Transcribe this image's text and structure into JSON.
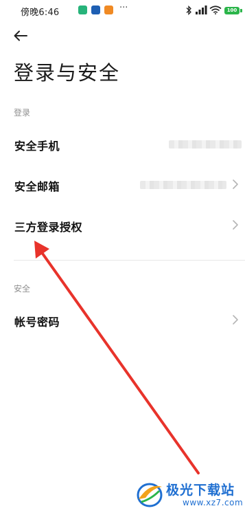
{
  "status_bar": {
    "time": "傍晚6:46",
    "overflow": "···",
    "battery": "100",
    "app_icon_colors": [
      "#27b37a",
      "#1e5fb3",
      "#f08a24"
    ]
  },
  "header": {
    "back_icon": "back-arrow-icon",
    "title": "登录与安全"
  },
  "sections": [
    {
      "label": "登录",
      "items": [
        {
          "label": "安全手机",
          "value_blurred": true,
          "chevron": false
        },
        {
          "label": "安全邮箱",
          "value_blurred": true,
          "chevron": true
        },
        {
          "label": "三方登录授权",
          "value_blurred": false,
          "chevron": true
        }
      ]
    },
    {
      "label": "安全",
      "items": [
        {
          "label": "帐号密码",
          "value_blurred": false,
          "chevron": true
        }
      ]
    }
  ],
  "annotation": {
    "color": "#e8332b"
  },
  "watermark": {
    "name": "极光下载站",
    "url": "www.xz7.com",
    "color": "#1f6fd1"
  }
}
